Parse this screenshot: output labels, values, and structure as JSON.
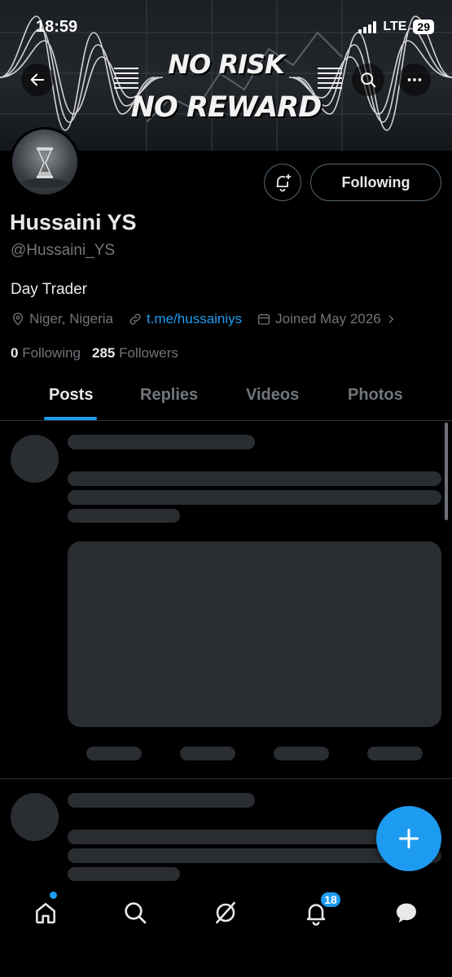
{
  "status_bar": {
    "time": "18:59",
    "network": "LTE",
    "battery": "29"
  },
  "banner": {
    "line1": "NO RISK",
    "line2": "NO REWARD"
  },
  "profile": {
    "name": "Hussaini YS",
    "handle": "@Hussaini_YS",
    "bio": "Day Trader",
    "location": "Niger, Nigeria",
    "link": "t.me/hussainiys",
    "joined": "Joined May 2026",
    "following_count": "0",
    "following_label": "Following",
    "followers_count": "285",
    "followers_label": "Followers",
    "follow_button": "Following"
  },
  "tabs": [
    "Posts",
    "Replies",
    "Videos",
    "Photos"
  ],
  "active_tab": "Posts",
  "bottom_nav": {
    "items": [
      "home-icon",
      "search-icon",
      "grok-icon",
      "notifications-icon",
      "messages-icon"
    ],
    "notification_badge": "18"
  },
  "colors": {
    "accent": "#1d9bf0",
    "background": "#000000",
    "muted": "#71767b"
  }
}
